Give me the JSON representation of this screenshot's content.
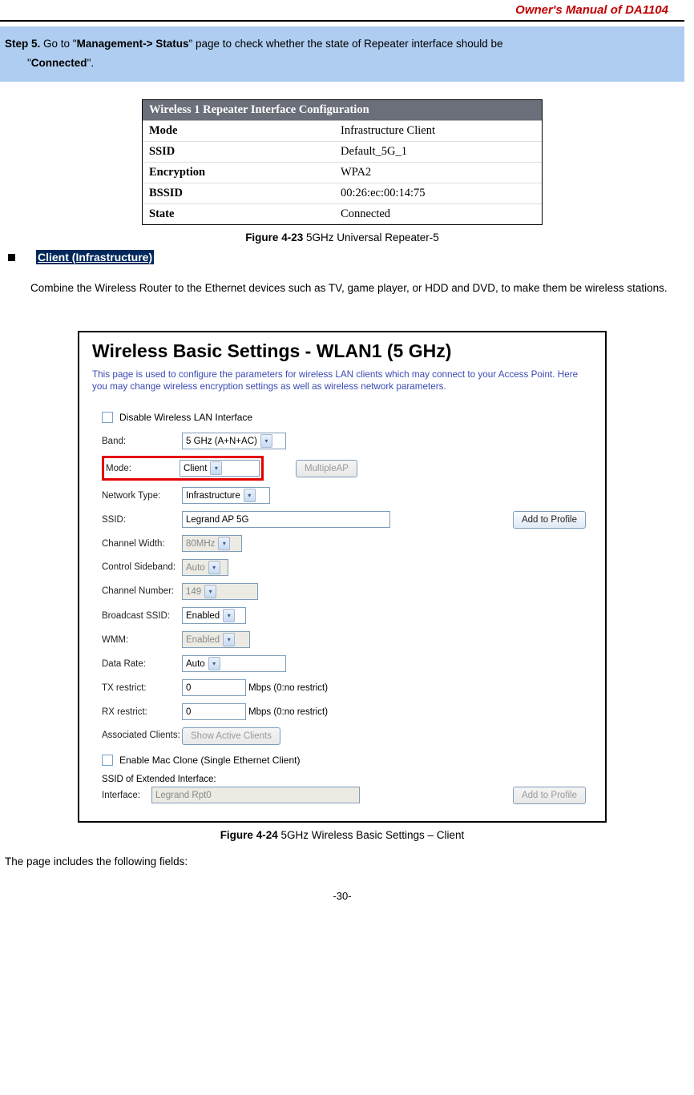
{
  "header": {
    "title": "Owner's Manual of DA1104"
  },
  "step": {
    "label": "Step 5.",
    "pre": "  Go to \"",
    "bold1": "Management-> Status",
    "mid": "\" page to check whether the state of Repeater interface should be",
    "line2pre": "\"",
    "bold2": "Connected",
    "line2post": "\"."
  },
  "table1": {
    "title": "Wireless 1 Repeater Interface Configuration",
    "rows": [
      {
        "label": "Mode",
        "value": "Infrastructure Client"
      },
      {
        "label": "SSID",
        "value": "Default_5G_1"
      },
      {
        "label": "Encryption",
        "value": "WPA2"
      },
      {
        "label": "BSSID",
        "value": "00:26:ec:00:14:75"
      },
      {
        "label": "State",
        "value": "Connected"
      }
    ]
  },
  "caption1": {
    "bold": "Figure 4-23",
    "rest": " 5GHz Universal Repeater-5"
  },
  "bullet": {
    "title": "Client (Infrastructure)"
  },
  "para1": "Combine the Wireless Router to the Ethernet devices such as TV, game player, or HDD and DVD, to make them be wireless stations.",
  "ss2": {
    "title": "Wireless Basic Settings - WLAN1 (5 GHz)",
    "desc": "This page is used to configure the parameters for wireless LAN clients which may connect to your Access Point. Here you may change wireless encryption settings as well as wireless network parameters.",
    "disable_lan": "Disable Wireless LAN Interface",
    "band_label": "Band:",
    "band_value": "5 GHz (A+N+AC)",
    "mode_label": "Mode:",
    "mode_value": "Client",
    "multipleap": "MultipleAP",
    "nettype_label": "Network Type:",
    "nettype_value": "Infrastructure",
    "ssid_label": "SSID:",
    "ssid_value": "Legrand AP 5G",
    "add_profile": "Add to Profile",
    "chanwidth_label": "Channel Width:",
    "chanwidth_value": "80MHz",
    "ctrlsb_label": "Control Sideband:",
    "ctrlsb_value": "Auto",
    "channum_label": "Channel Number:",
    "channum_value": "149",
    "bssid_label": "Broadcast SSID:",
    "bssid_value": "Enabled",
    "wmm_label": "WMM:",
    "wmm_value": "Enabled",
    "datarate_label": "Data Rate:",
    "datarate_value": "Auto",
    "tx_label": "TX restrict:",
    "tx_value": "0",
    "rx_label": "RX restrict:",
    "rx_value": "0",
    "mbps_note": "Mbps (0:no restrict)",
    "assoc_label": "Associated Clients:",
    "show_clients": "Show Active Clients",
    "macclone": "Enable Mac Clone (Single Ethernet Client)",
    "ssid_ext_label": "SSID of Extended Interface:",
    "ssid_ext_value": "Legrand Rpt0"
  },
  "caption2": {
    "bold": "Figure 4-24",
    "rest": " 5GHz Wireless Basic Settings – Client"
  },
  "bottom_para": "The page includes the following fields:",
  "page_num": "-30-"
}
